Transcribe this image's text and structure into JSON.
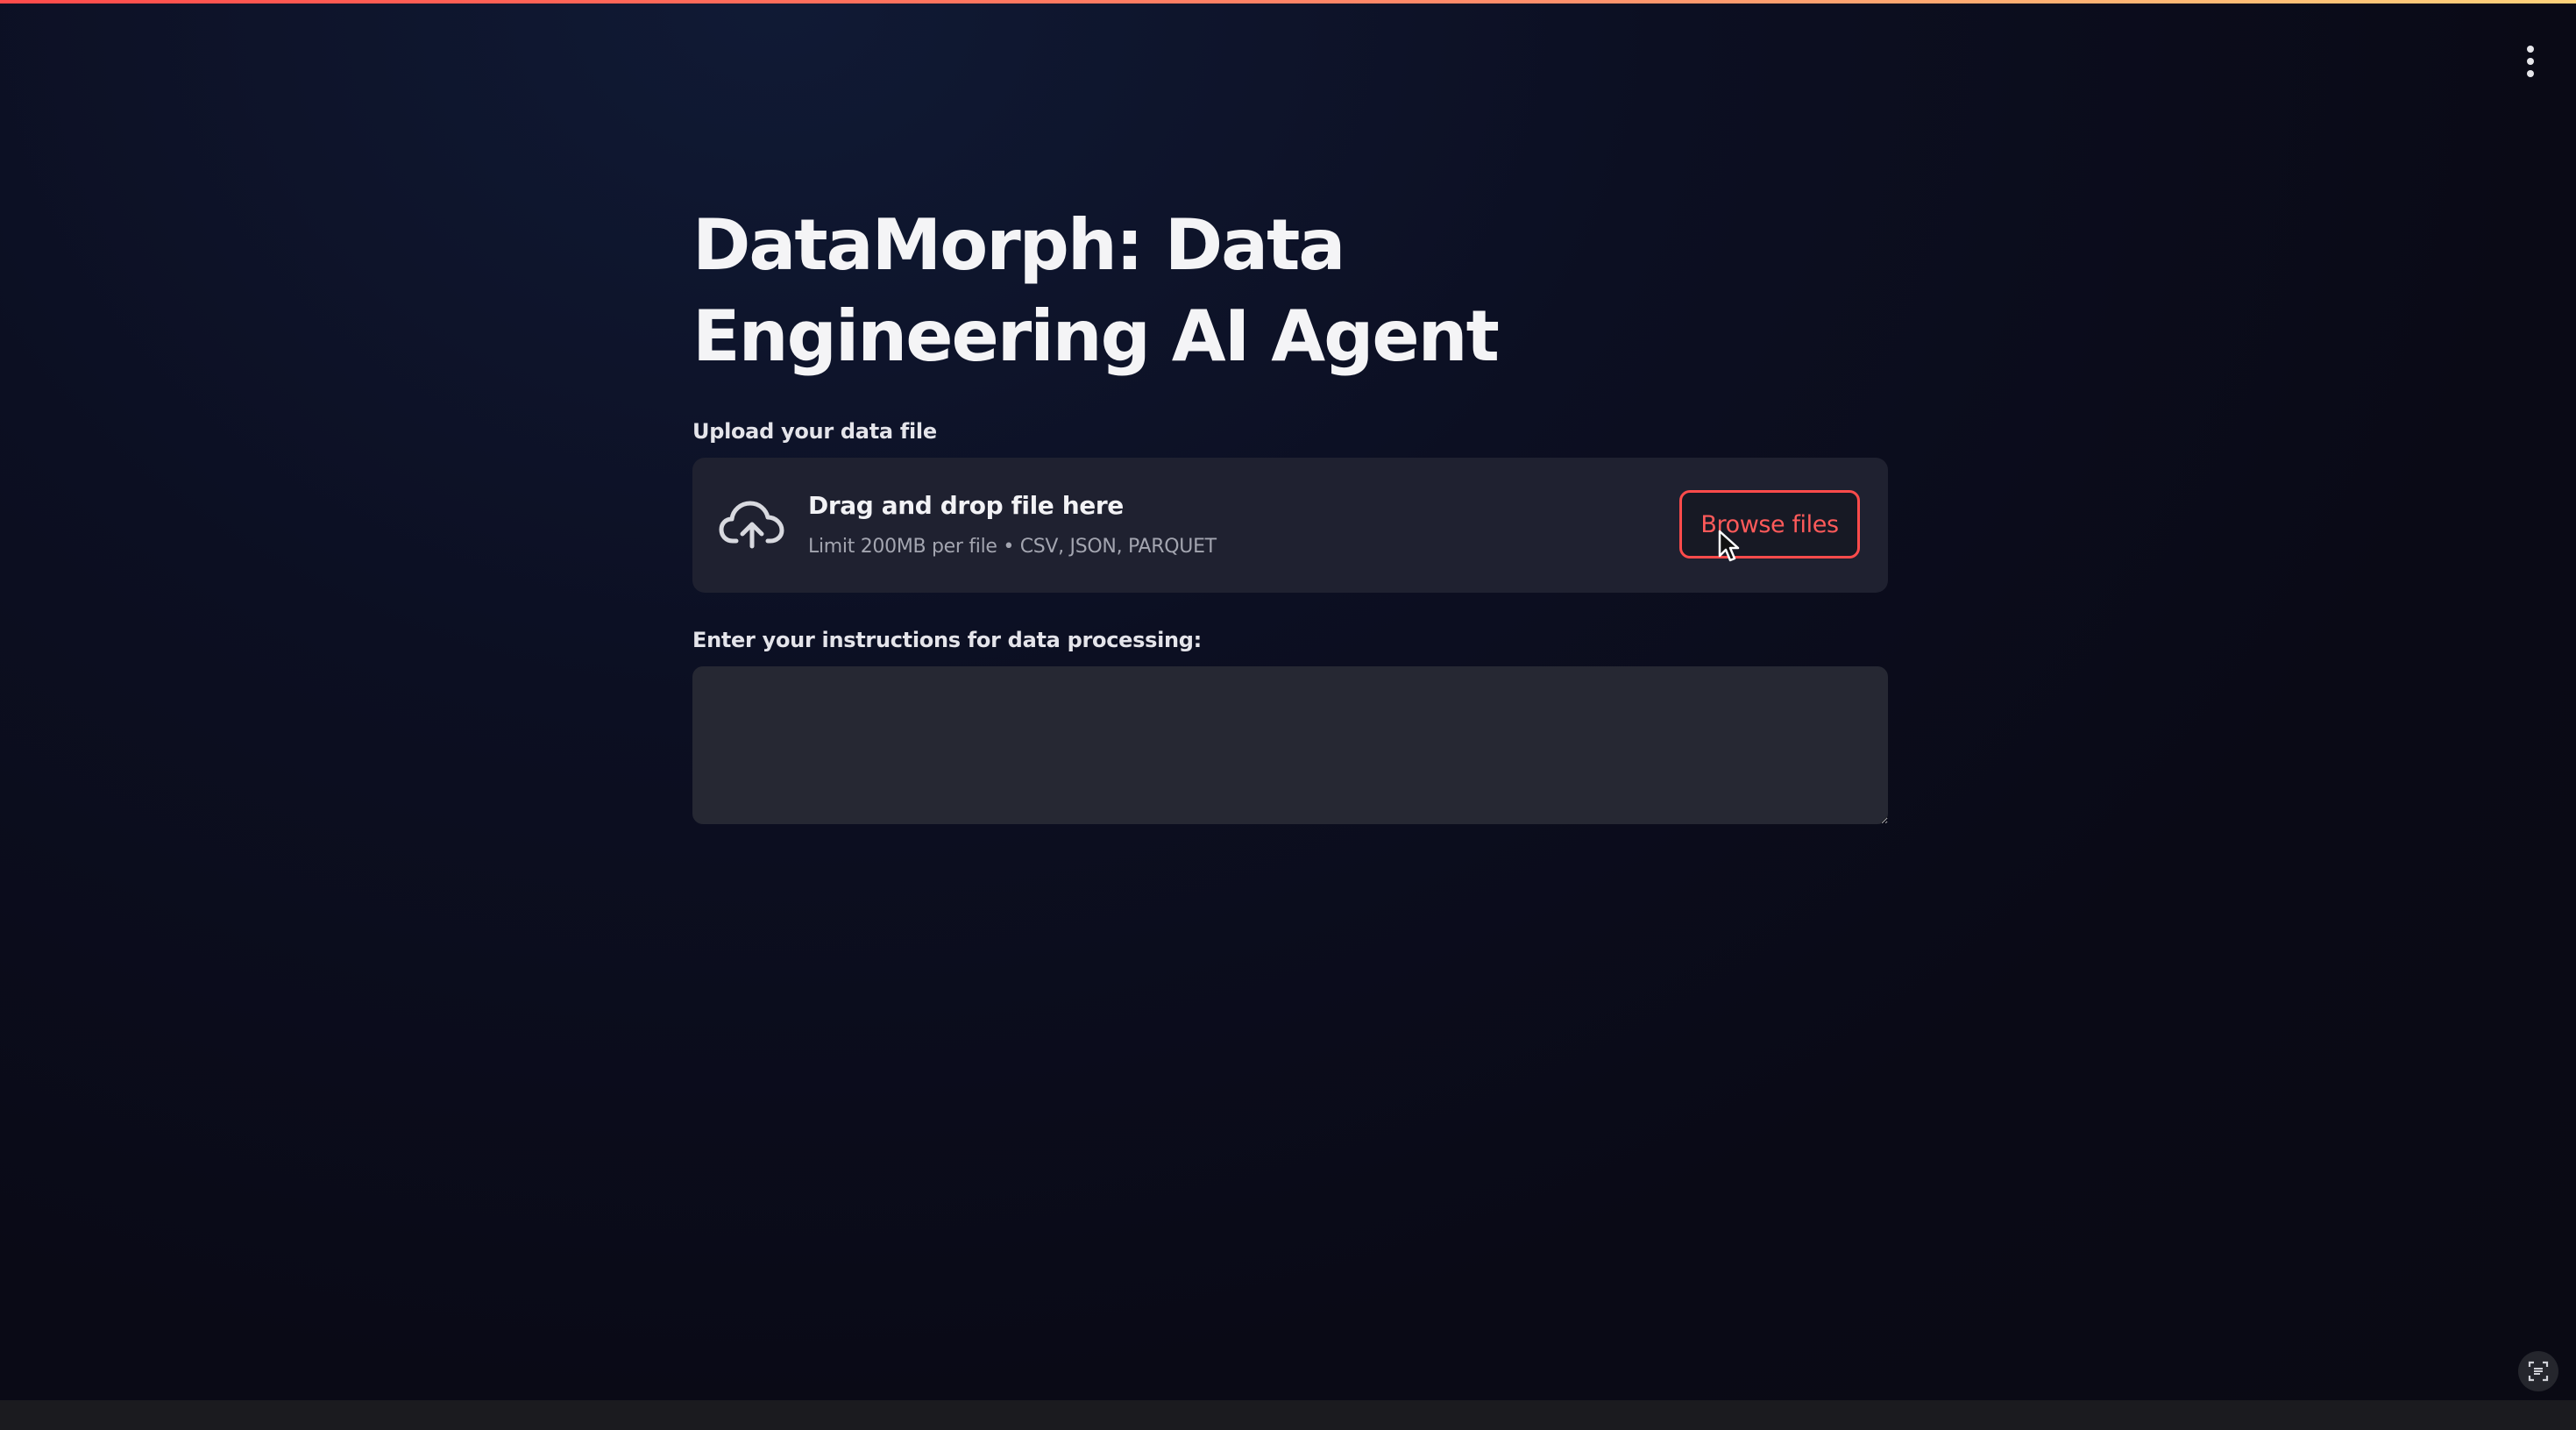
{
  "app": {
    "title": "DataMorph: Data Engineering AI Agent",
    "accent_color": "#ff4b4b"
  },
  "header": {
    "menu_icon": "vertical-ellipsis-icon"
  },
  "uploader": {
    "label": "Upload your data file",
    "icon": "cloud-upload-icon",
    "drop_text": "Drag and drop file here",
    "limit_text": "Limit 200MB per file • CSV, JSON, PARQUET",
    "browse_label": "Browse files"
  },
  "instructions": {
    "label": "Enter your instructions for data processing:",
    "value": ""
  },
  "footer": {
    "status_icon": "screencast-icon"
  }
}
